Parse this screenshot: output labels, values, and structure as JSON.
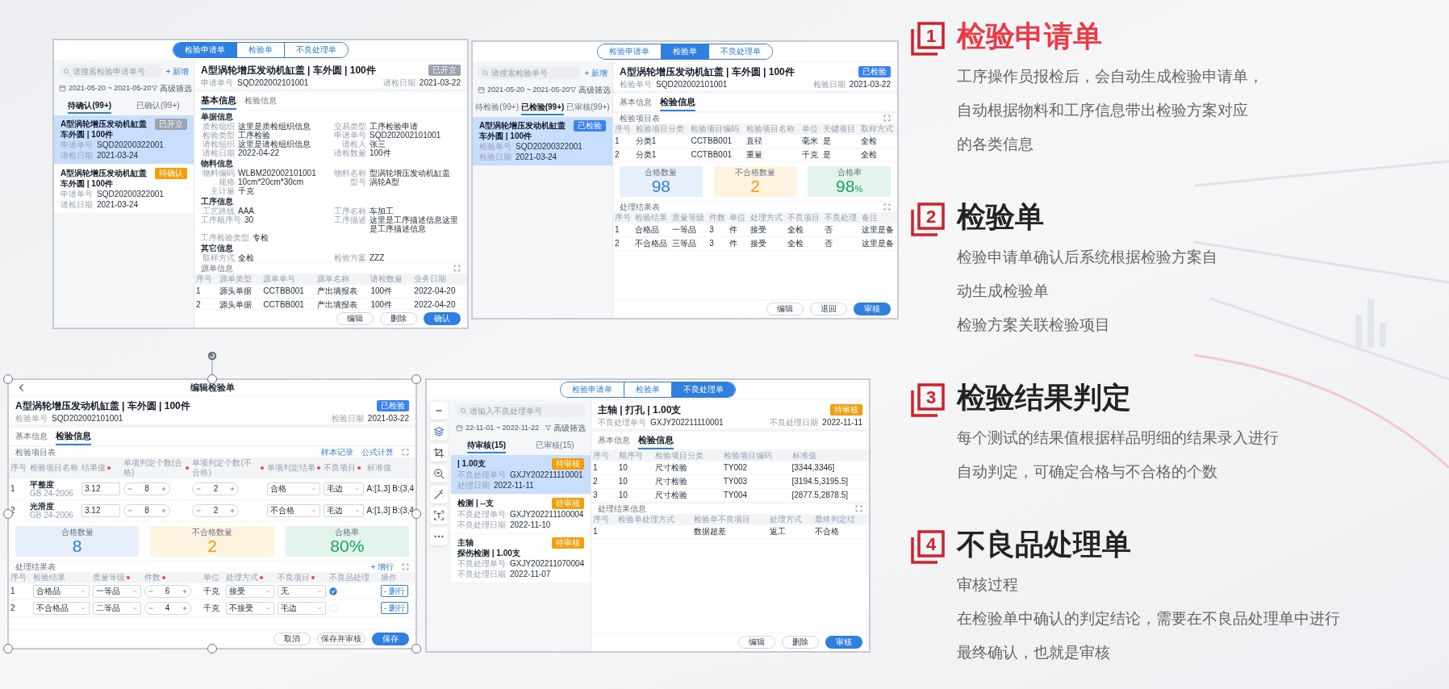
{
  "panels": [
    {
      "kind": "list-detail",
      "tabs": [
        {
          "label": "检验申请单",
          "selected": true
        },
        {
          "label": "检验单",
          "selected": false
        },
        {
          "label": "不良处理单",
          "selected": false
        }
      ],
      "list": {
        "search": {
          "placeholder": "请搜索检验申请单号"
        },
        "add": "+ 新增",
        "date_range": "2021-05-20 ~ 2021-05-20",
        "filter": "高级筛选",
        "subtabs": [
          {
            "label": "待确认(99+)",
            "selected": true
          },
          {
            "label": "已确认(99+)",
            "selected": false
          }
        ],
        "cards": [
          {
            "lines": [
              "A型涡轮增压发动机缸盖",
              "车外圆 | 100件"
            ],
            "badge": {
              "text": "已开立",
              "color": "#9ca3af"
            },
            "fields": [
              {
                "label": "申请单号",
                "value": "SQD20200322001"
              },
              {
                "label": "请检日期",
                "value": "2021-03-24"
              }
            ],
            "selected": true
          },
          {
            "lines": [
              "A型涡轮增压发动机缸盖",
              "车外圆 | 100件"
            ],
            "badge": {
              "text": "待确认",
              "color": "#f59e0b"
            },
            "fields": [
              {
                "label": "申请单号",
                "value": "SQD20200322001"
              },
              {
                "label": "请检日期",
                "value": "2021-03-24"
              }
            ],
            "selected": false
          }
        ]
      },
      "detail": {
        "title": "A型涡轮增压发动机缸盖 | 车外圆 | 100件",
        "badge": {
          "text": "已开立",
          "color": "#9ca3af"
        },
        "meta": [
          {
            "label": "申请单号",
            "value": "SQD202002101001"
          },
          {
            "label": "请检日期",
            "value": "2021-03-22"
          }
        ],
        "tabs": [
          {
            "label": "基本信息",
            "selected": true
          },
          {
            "label": "检验信息",
            "selected": false
          }
        ],
        "sections": [
          {
            "kind": "fields",
            "title": "单据信息",
            "fields": [
              {
                "label": "质检组织",
                "value": "这里是质检组织信息"
              },
              {
                "label": "交易类型",
                "value": "工序检验申请"
              },
              {
                "label": "检验类型",
                "value": "工序检验"
              },
              {
                "label": "申请单号",
                "value": "SQD202002101001"
              },
              {
                "label": "请检组织",
                "value": "这里是请检组织信息"
              },
              {
                "label": "请检人",
                "value": "张三"
              },
              {
                "label": "请检日期",
                "value": "2022-04-22"
              },
              {
                "label": "请检数量",
                "value": "100件"
              }
            ]
          },
          {
            "kind": "fields",
            "title": "物料信息",
            "fields": [
              {
                "label": "物料编码",
                "value": "WLBM202002101001"
              },
              {
                "label": "物料名称",
                "value": "型涡轮增压发动机缸盖"
              },
              {
                "label": "规格",
                "value": "10cm*20cm*30cm"
              },
              {
                "label": "型号",
                "value": "涡轮A型"
              },
              {
                "label": "主计量",
                "value": "千克"
              }
            ]
          },
          {
            "kind": "fields",
            "title": "工序信息",
            "fields": [
              {
                "label": "工艺路线",
                "value": "AAA"
              },
              {
                "label": "工序名称",
                "value": "车加工"
              },
              {
                "label": "工序顺序号",
                "value": "30"
              },
              {
                "label": "工序描述",
                "value": "这里是工序描述信息这里是工序描述信息"
              },
              {
                "label": "工序检验类型",
                "value": "专检"
              }
            ]
          },
          {
            "kind": "fields",
            "title": "其它信息",
            "fields": [
              {
                "label": "取样方式",
                "value": "全检"
              },
              {
                "label": "检验方案",
                "value": "ZZZ"
              }
            ]
          },
          {
            "kind": "table",
            "title": "源单信息",
            "expand": true,
            "columns": [
              {
                "label": "序号",
                "required": false
              },
              {
                "label": "源单类型",
                "required": false
              },
              {
                "label": "源单单号",
                "required": false
              },
              {
                "label": "源单名称",
                "required": false
              },
              {
                "label": "请检数量",
                "required": false
              },
              {
                "label": "业务日期",
                "required": false
              }
            ],
            "rows": [
              [
                "1",
                "源头单据",
                "CCTBB001",
                "产出填报表",
                "100件",
                "2022-04-20"
              ],
              [
                "2",
                "源头单据",
                "CCTBB001",
                "产出填报表",
                "100件",
                "2022-04-20"
              ]
            ]
          }
        ],
        "buttons": [
          {
            "label": "编辑",
            "primary": false
          },
          {
            "label": "删除",
            "primary": false
          },
          {
            "label": "确认",
            "primary": true
          }
        ]
      }
    },
    {
      "kind": "list-detail",
      "tabs": [
        {
          "label": "检验申请单",
          "selected": false
        },
        {
          "label": "检验单",
          "selected": true
        },
        {
          "label": "不良处理单",
          "selected": false
        }
      ],
      "list": {
        "search": {
          "placeholder": "请搜索检验单号"
        },
        "add": "+ 新增",
        "date_range": "2021-05-20 ~ 2021-05-20",
        "filter": "高级筛选",
        "subtabs": [
          {
            "label": "待检验(99+)",
            "selected": false
          },
          {
            "label": "已检验(99+)",
            "selected": true
          },
          {
            "label": "已审核(99+)",
            "selected": false
          }
        ],
        "cards": [
          {
            "lines": [
              "A型涡轮增压发动机缸盖",
              "车外圆 | 100件"
            ],
            "badge": {
              "text": "已检验",
              "color": "#3b82f6"
            },
            "fields": [
              {
                "label": "检验单号",
                "value": "SQD20200322001"
              },
              {
                "label": "检验日期",
                "value": "2021-03-24"
              }
            ],
            "selected": true
          }
        ]
      },
      "detail": {
        "title": "A型涡轮增压发动机缸盖 | 车外圆 | 100件",
        "badge": {
          "text": "已检验",
          "color": "#3b82f6"
        },
        "meta": [
          {
            "label": "检验单号",
            "value": "SQD202002101001"
          },
          {
            "label": "检验日期",
            "value": "2021-03-22"
          }
        ],
        "tabs": [
          {
            "label": "基本信息",
            "selected": false
          },
          {
            "label": "检验信息",
            "selected": true
          }
        ],
        "sections": [
          {
            "kind": "table",
            "title": "检验项目表",
            "expand": true,
            "columns": [
              {
                "label": "序号",
                "required": false
              },
              {
                "label": "检验项目分类",
                "required": false
              },
              {
                "label": "检验项目编码",
                "required": false
              },
              {
                "label": "检验项目名称",
                "required": false
              },
              {
                "label": "单位",
                "required": false
              },
              {
                "label": "关键项目",
                "required": false
              },
              {
                "label": "取样方式",
                "required": false
              }
            ],
            "rows": [
              [
                "1",
                "分类1",
                "CCTBB001",
                "直径",
                "毫米",
                "是",
                "全检"
              ],
              [
                "2",
                "分类1",
                "CCTBB001",
                "重量",
                "千克",
                "是",
                "全检"
              ]
            ]
          },
          {
            "kind": "stats",
            "cards": [
              {
                "label": "合格数量",
                "value": "98",
                "color": "#2f7fe0"
              },
              {
                "label": "不合格数量",
                "value": "2",
                "color": "#f59e0b"
              },
              {
                "label": "合格率",
                "value": "98",
                "unit": "%",
                "color": "#16a36a"
              }
            ]
          },
          {
            "kind": "table",
            "title": "处理结果表",
            "expand": true,
            "columns": [
              {
                "label": "序号",
                "required": false
              },
              {
                "label": "检验结果",
                "required": false
              },
              {
                "label": "质量等级",
                "required": false
              },
              {
                "label": "件数",
                "required": false
              },
              {
                "label": "单位",
                "required": false
              },
              {
                "label": "处理方式",
                "required": false
              },
              {
                "label": "不良项目",
                "required": false
              },
              {
                "label": "不良处理",
                "required": false
              },
              {
                "label": "备注",
                "required": false
              }
            ],
            "rows": [
              [
                "1",
                "合格品",
                "一等品",
                "3",
                "件",
                "接受",
                "全检",
                "否",
                "这里是备"
              ],
              [
                "2",
                "不合格品",
                "三等品",
                "3",
                "件",
                "接受",
                "全检",
                "否",
                "这里是备"
              ]
            ]
          }
        ],
        "buttons": [
          {
            "label": "编辑",
            "primary": false
          },
          {
            "label": "退回",
            "primary": false
          },
          {
            "label": "审核",
            "primary": true
          }
        ]
      }
    },
    {
      "kind": "editor",
      "heading": "编辑检验单",
      "detail": {
        "title": "A型涡轮增压发动机缸盖 | 车外圆 | 100件",
        "badge": {
          "text": "已检验",
          "color": "#3b82f6"
        },
        "meta": [
          {
            "label": "检验单号",
            "value": "SQD202002101001"
          },
          {
            "label": "检验日期",
            "value": "2021-03-22"
          }
        ],
        "tabs": [
          {
            "label": "基本信息",
            "selected": false
          },
          {
            "label": "检验信息",
            "selected": true
          }
        ],
        "sections": [
          {
            "kind": "table",
            "title": "检验项目表",
            "links": [
              "样本记录",
              "公式计算"
            ],
            "expand": true,
            "columns": [
              {
                "label": "序号",
                "required": false
              },
              {
                "label": "检验项目名称",
                "required": false
              },
              {
                "label": "结果值",
                "required": true
              },
              {
                "label": "单项判定个数(合格)",
                "required": true
              },
              {
                "label": "单项判定个数(不合格)",
                "required": true
              },
              {
                "label": "单项判定结果",
                "required": true
              },
              {
                "label": "不良项目",
                "required": true
              },
              {
                "label": "标准值",
                "required": false
              }
            ],
            "rows": [
              [
                "1",
                {
                  "kind": "item",
                  "name": "平整度",
                  "sub": "GB 24-2006"
                },
                {
                  "kind": "input",
                  "value": "3.12"
                },
                {
                  "kind": "stepper",
                  "value": "8"
                },
                {
                  "kind": "stepper",
                  "value": "2"
                },
                {
                  "kind": "select",
                  "value": "合格"
                },
                {
                  "kind": "select",
                  "value": "毛边"
                },
                "A:[1,3] B:(3,4"
              ],
              [
                "2",
                {
                  "kind": "item",
                  "name": "光滑度",
                  "sub": "GB 24-2006"
                },
                {
                  "kind": "input",
                  "value": "3.12"
                },
                {
                  "kind": "stepper",
                  "value": "8"
                },
                {
                  "kind": "stepper",
                  "value": "2"
                },
                {
                  "kind": "select",
                  "value": "不合格"
                },
                {
                  "kind": "select",
                  "value": "毛边"
                },
                "A:[1,3] B:(3,4"
              ]
            ]
          },
          {
            "kind": "stats",
            "cards": [
              {
                "label": "合格数量",
                "value": "8",
                "color": "#2f7fe0"
              },
              {
                "label": "不合格数量",
                "value": "2",
                "color": "#f59e0b"
              },
              {
                "label": "合格率",
                "value": "80%",
                "color": "#16a36a"
              }
            ]
          },
          {
            "kind": "table",
            "title": "处理结果表",
            "links": [
              "+ 增行"
            ],
            "expand": true,
            "columns": [
              {
                "label": "序号",
                "required": false
              },
              {
                "label": "检验结果",
                "required": false
              },
              {
                "label": "质量等级",
                "required": true
              },
              {
                "label": "件数",
                "required": true
              },
              {
                "label": "单位",
                "required": false
              },
              {
                "label": "处理方式",
                "required": true
              },
              {
                "label": "不良项目",
                "required": true
              },
              {
                "label": "不良品处理",
                "required": false
              },
              {
                "label": "操作",
                "required": false
              }
            ],
            "rows": [
              [
                "1",
                {
                  "kind": "select",
                  "value": "合格品"
                },
                {
                  "kind": "select",
                  "value": "一等品"
                },
                {
                  "kind": "stepper",
                  "value": "6"
                },
                "千克",
                {
                  "kind": "select",
                  "value": "接受"
                },
                {
                  "kind": "select",
                  "value": "无"
                },
                {
                  "kind": "check",
                  "checked": true
                },
                {
                  "kind": "button",
                  "label": "- 删行"
                }
              ],
              [
                "2",
                {
                  "kind": "select",
                  "value": "不合格品"
                },
                {
                  "kind": "select",
                  "value": "二等品"
                },
                {
                  "kind": "stepper",
                  "value": "4"
                },
                "千克",
                {
                  "kind": "select",
                  "value": "不接受"
                },
                {
                  "kind": "select",
                  "value": "毛边"
                },
                {
                  "kind": "check",
                  "checked": false
                },
                {
                  "kind": "button",
                  "label": "- 删行"
                }
              ]
            ]
          }
        ],
        "buttons": [
          {
            "label": "取消",
            "primary": false
          },
          {
            "label": "保存并审核",
            "primary": false
          },
          {
            "label": "保存",
            "primary": true
          }
        ]
      }
    },
    {
      "kind": "list-detail",
      "tabs": [
        {
          "label": "检验申请单",
          "selected": false
        },
        {
          "label": "检验单",
          "selected": false
        },
        {
          "label": "不良处理单",
          "selected": true
        }
      ],
      "toolbar": [
        {
          "kind": "zoom-out"
        },
        {
          "kind": "layers"
        },
        {
          "kind": "crop"
        },
        {
          "kind": "zoom-in"
        },
        {
          "kind": "wand"
        },
        {
          "kind": "text-scan"
        },
        {
          "kind": "more"
        }
      ],
      "list": {
        "search": {
          "placeholder": "请输入不良处理单号"
        },
        "date_range": "22-11-01 ~ 2022-11-22",
        "filter": "高级筛选",
        "subtabs": [
          {
            "label": "待审核(15)",
            "selected": true
          },
          {
            "label": "已审核(15)",
            "selected": false
          }
        ],
        "cards": [
          {
            "lines": [
              "| 1.00支"
            ],
            "badge": {
              "text": "待审核",
              "color": "#f59e0b"
            },
            "fields": [
              {
                "label": "不良处理单号",
                "value": "GXJY202211110001"
              },
              {
                "label": "处理日期",
                "value": "2022-11-11"
              }
            ],
            "selected": true
          },
          {
            "lines": [
              "检测 | --支"
            ],
            "badge": {
              "text": "待审核",
              "color": "#f59e0b"
            },
            "fields": [
              {
                "label": "不良处理单号",
                "value": "GXJY202211100004"
              },
              {
                "label": "不良处理日期",
                "value": "2022-11-10"
              }
            ],
            "selected": false
          },
          {
            "lines": [
              "主轴",
              "探伤检测 | 1.00支"
            ],
            "badge": {
              "text": "待审核",
              "color": "#f59e0b"
            },
            "fields": [
              {
                "label": "不良处理单号",
                "value": "GXJY202211070004"
              },
              {
                "label": "不良处理日期",
                "value": "2022-11-07"
              }
            ],
            "selected": false
          }
        ]
      },
      "detail": {
        "title": "主轴 | 打孔 | 1.00支",
        "badge": {
          "text": "待审核",
          "color": "#f59e0b"
        },
        "meta": [
          {
            "label": "不良处理单号",
            "value": "GXJY202211110001"
          },
          {
            "label": "不良处理日期",
            "value": "2022-11-11"
          }
        ],
        "tabs": [
          {
            "label": "基本信息",
            "selected": false
          },
          {
            "label": "检验信息",
            "selected": true
          }
        ],
        "sections": [
          {
            "kind": "table",
            "columns": [
              {
                "label": "序号",
                "required": false
              },
              {
                "label": "顺序号",
                "required": false
              },
              {
                "label": "检验项目分类",
                "required": false
              },
              {
                "label": "检验项目编码",
                "required": false
              },
              {
                "label": "标准值",
                "required": false
              }
            ],
            "rows": [
              [
                "1",
                "10",
                "尺寸检验",
                "TY002",
                "[3344,3346]"
              ],
              [
                "2",
                "10",
                "尺寸检验",
                "TY003",
                "[3194.5,3195.5]"
              ],
              [
                "3",
                "10",
                "尺寸检验",
                "TY004",
                "[2877.5,2878.5]"
              ]
            ]
          },
          {
            "kind": "table",
            "title": "处理结果信息",
            "expand": true,
            "columns": [
              {
                "label": "序号",
                "required": false
              },
              {
                "label": "检验单处理方式",
                "required": false
              },
              {
                "label": "检验单不良项目",
                "required": false
              },
              {
                "label": "处理方式",
                "required": false
              },
              {
                "label": "最终判定结",
                "required": false
              }
            ],
            "rows": [
              [
                "1",
                null,
                "数据超差",
                "返工",
                "不合格"
              ]
            ]
          }
        ],
        "buttons": [
          {
            "label": "编辑",
            "primary": false
          },
          {
            "label": "删除",
            "primary": false
          },
          {
            "label": "审核",
            "primary": true
          }
        ]
      }
    }
  ],
  "features": [
    {
      "number": "1",
      "title": "检验申请单",
      "active": true,
      "lines": [
        "工序操作员报检后，会自动生成检验申请单，",
        "自动根据物料和工序信息带出检验方案对应",
        "的各类信息"
      ]
    },
    {
      "number": "2",
      "title": "检验单",
      "active": false,
      "lines": [
        "检验申请单确认后系统根据检验方案自",
        "动生成检验单",
        "检验方案关联检验项目"
      ]
    },
    {
      "number": "3",
      "title": "检验结果判定",
      "active": false,
      "lines": [
        "每个测试的结果值根据样品明细的结果录入进行",
        "自动判定，可确定合格与不合格的个数"
      ]
    },
    {
      "number": "4",
      "title": "不良品处理单",
      "active": false,
      "lines": [
        "审核过程",
        "在检验单中确认的判定结论，需要在不良品处理单中进行",
        "最终确认，也就是审核"
      ]
    }
  ]
}
